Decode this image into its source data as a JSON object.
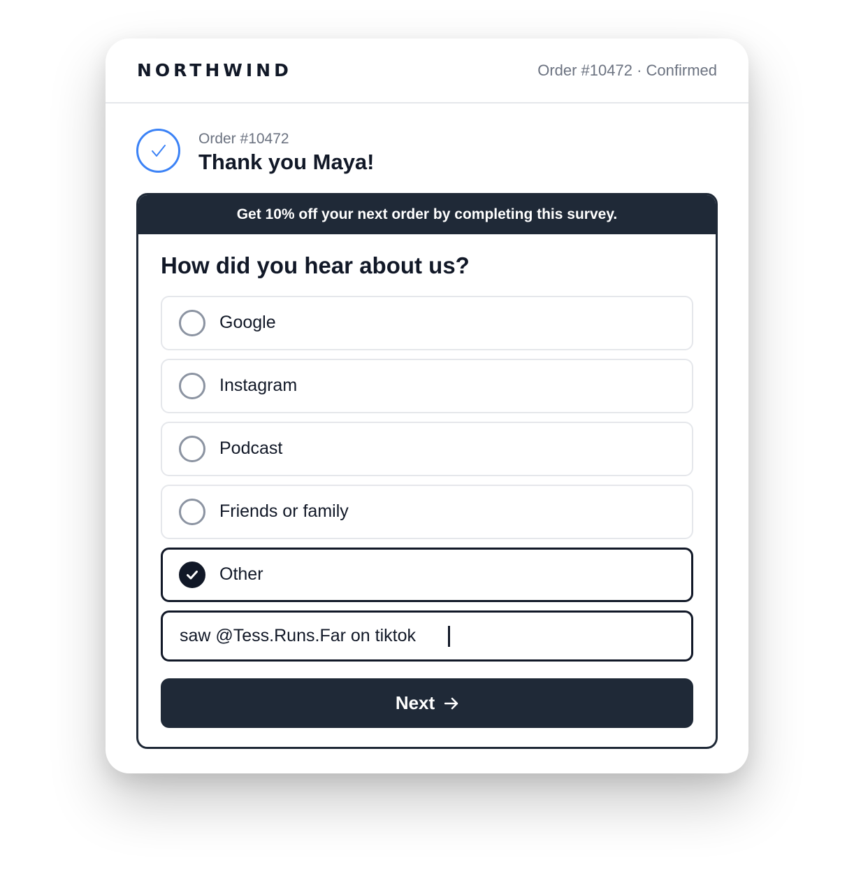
{
  "header": {
    "brand": "NORTHWIND",
    "status": "Order #10472 · Confirmed"
  },
  "confirmation": {
    "icon": "check-circle-icon",
    "order_label": "Order #10472",
    "title": "Thank you Maya!"
  },
  "survey": {
    "banner": "Get 10% off your next order by completing this survey.",
    "question": "How did you hear about us?",
    "options": [
      {
        "label": "Google",
        "selected": false
      },
      {
        "label": "Instagram",
        "selected": false
      },
      {
        "label": "Podcast",
        "selected": false
      },
      {
        "label": "Friends or family",
        "selected": false
      },
      {
        "label": "Other",
        "selected": true
      }
    ],
    "other_value": "saw @Tess.Runs.Far on tiktok",
    "next_label": "Next",
    "next_icon": "arrow-right-icon"
  },
  "colors": {
    "accent": "#3b82f6",
    "dark": "#1f2937",
    "muted": "#6b7280",
    "border": "#e5e7eb"
  }
}
